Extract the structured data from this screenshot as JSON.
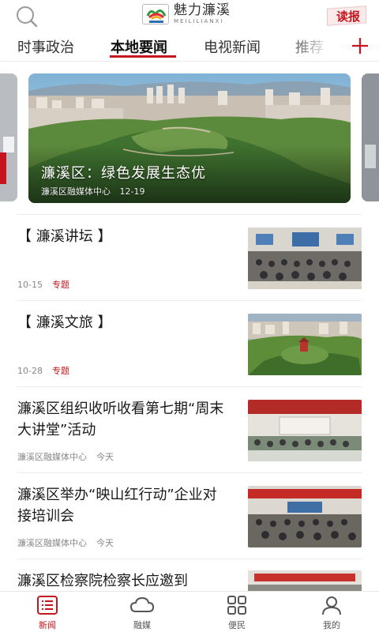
{
  "header": {
    "logo_cn": "魅力濂溪",
    "logo_en": "MEILILIANXI",
    "read_label": "读报",
    "icons": {
      "search": "search-icon",
      "add": "plus-icon"
    }
  },
  "tabs": [
    {
      "label": "时事政治",
      "active": false
    },
    {
      "label": "本地要闻",
      "active": true
    },
    {
      "label": "电视新闻",
      "active": false
    },
    {
      "label": "推荐",
      "active": false
    }
  ],
  "carousel": {
    "title": "濂溪区：绿色发展生态优",
    "source": "濂溪区融媒体中心",
    "date": "12-19"
  },
  "news": [
    {
      "title": "【 濂溪讲坛 】",
      "date": "10-15",
      "tag": "专题"
    },
    {
      "title": "【 濂溪文旅 】",
      "date": "10-28",
      "tag": "专题"
    },
    {
      "title": "濂溪区组织收听收看第七期“周末大讲堂”活动",
      "source": "濂溪区融媒体中心",
      "time": "今天"
    },
    {
      "title": "濂溪区举办“映山红行动”企业对接培训会",
      "source": "濂溪区融媒体中心",
      "time": "今天"
    },
    {
      "title": "濂溪区检察院检察长应邀到"
    }
  ],
  "bottom_nav": [
    {
      "label": "新闻",
      "icon": "news-icon",
      "active": true
    },
    {
      "label": "融媒",
      "icon": "cloud-icon",
      "active": false
    },
    {
      "label": "便民",
      "icon": "grid-icon",
      "active": false
    },
    {
      "label": "我的",
      "icon": "user-icon",
      "active": false
    }
  ],
  "colors": {
    "accent": "#c4161c",
    "text": "#1a1a1a",
    "meta": "#888888",
    "divider": "#ececec"
  }
}
